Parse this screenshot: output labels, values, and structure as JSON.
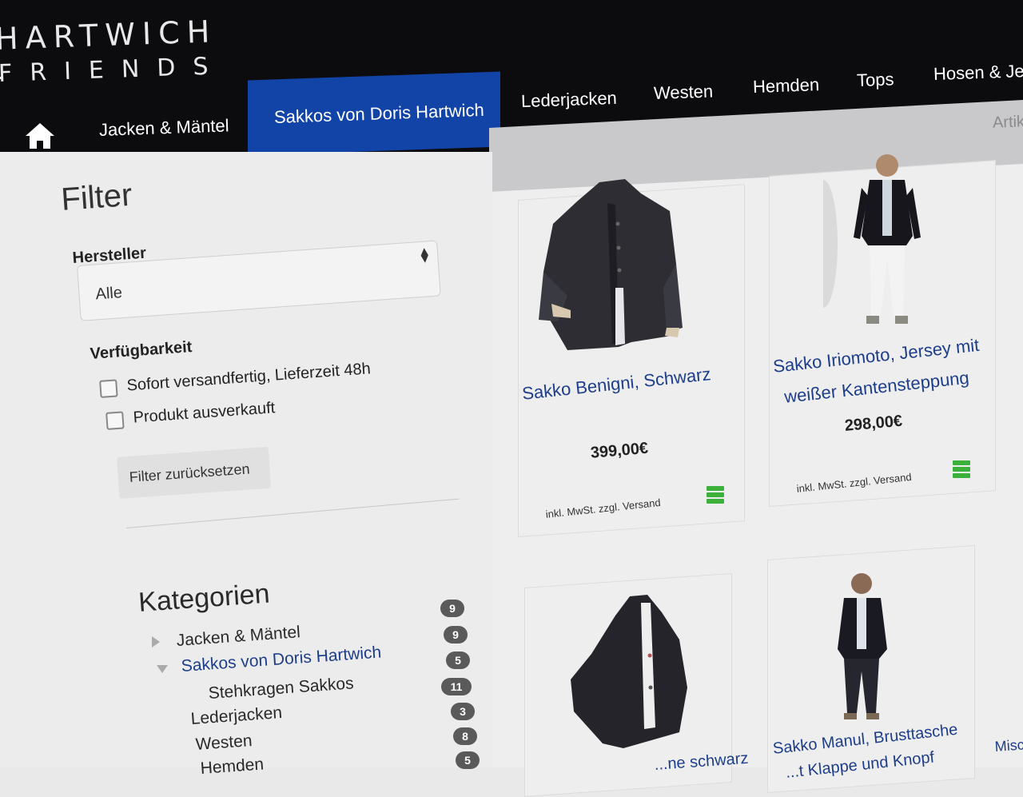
{
  "brand": {
    "line1": "HARTWICH",
    "line2": "FRIENDS"
  },
  "nav": {
    "items": [
      "Jacken & Mäntel",
      "Sakkos von Doris Hartwich",
      "Lederjacken",
      "Westen",
      "Hemden",
      "Tops",
      "Hosen & Jear"
    ],
    "active": "Sakkos von Doris Hartwich",
    "right_cut": "Artik"
  },
  "filter": {
    "title": "Filter",
    "manufacturer_label": "Hersteller",
    "manufacturer_value": "Alle",
    "availability_label": "Verfügbarkeit",
    "options": [
      "Sofort versandfertig, Lieferzeit 48h",
      "Produkt ausverkauft"
    ],
    "reset_label": "Filter zurücksetzen"
  },
  "categories": {
    "title": "Kategorien",
    "items": [
      {
        "label": "Jacken & Mäntel",
        "count": "9"
      },
      {
        "label": "Sakkos von Doris Hartwich",
        "count": "9"
      },
      {
        "label": "Stehkragen Sakkos",
        "count": "5"
      },
      {
        "label": "Lederjacken",
        "count": "11"
      },
      {
        "label": "Westen",
        "count": "3"
      },
      {
        "label": "Hemden",
        "count": "8"
      },
      {
        "label": "",
        "count": "5"
      }
    ]
  },
  "products": [
    {
      "name": "Sakko Benigni, Schwarz",
      "price": "399,00€",
      "note": "inkl. MwSt. zzgl. Versand"
    },
    {
      "name_line1": "Sakko Iriomoto, Jersey mit",
      "name_line2": "weißer Kantensteppung",
      "price": "298,00€",
      "note": "inkl. MwSt. zzgl. Versand"
    },
    {
      "name": "...ne schwarz"
    },
    {
      "name_line1": "Sakko Manul, Brusttasche",
      "name_line2": "...t Klappe und Knopf"
    },
    {
      "name": "Misc"
    }
  ],
  "colors": {
    "accent": "#1244a8",
    "link": "#1d3e8a",
    "stock": "#3bb03b",
    "header": "#0c0c0f"
  }
}
